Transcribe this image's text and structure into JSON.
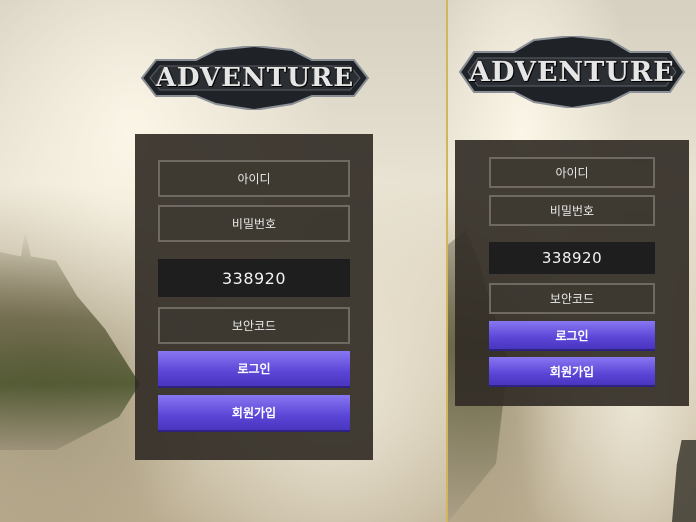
{
  "left": {
    "logo_text": "ADVENTURE",
    "id_label": "아이디",
    "password_label": "비밀번호",
    "captcha_value": "338920",
    "security_code_label": "보안코드",
    "login_label": "로그인",
    "signup_label": "회원가입"
  },
  "right": {
    "logo_text": "ADVENTURE",
    "id_label": "아이디",
    "password_label": "비밀번호",
    "captcha_value": "338920",
    "security_code_label": "보안코드",
    "login_label": "로그인",
    "signup_label": "회원가입"
  },
  "colors": {
    "divider": "#d3b45f",
    "button": "#6b57e0",
    "panel": "#32302a",
    "captcha_bg": "#1e1e1e"
  }
}
